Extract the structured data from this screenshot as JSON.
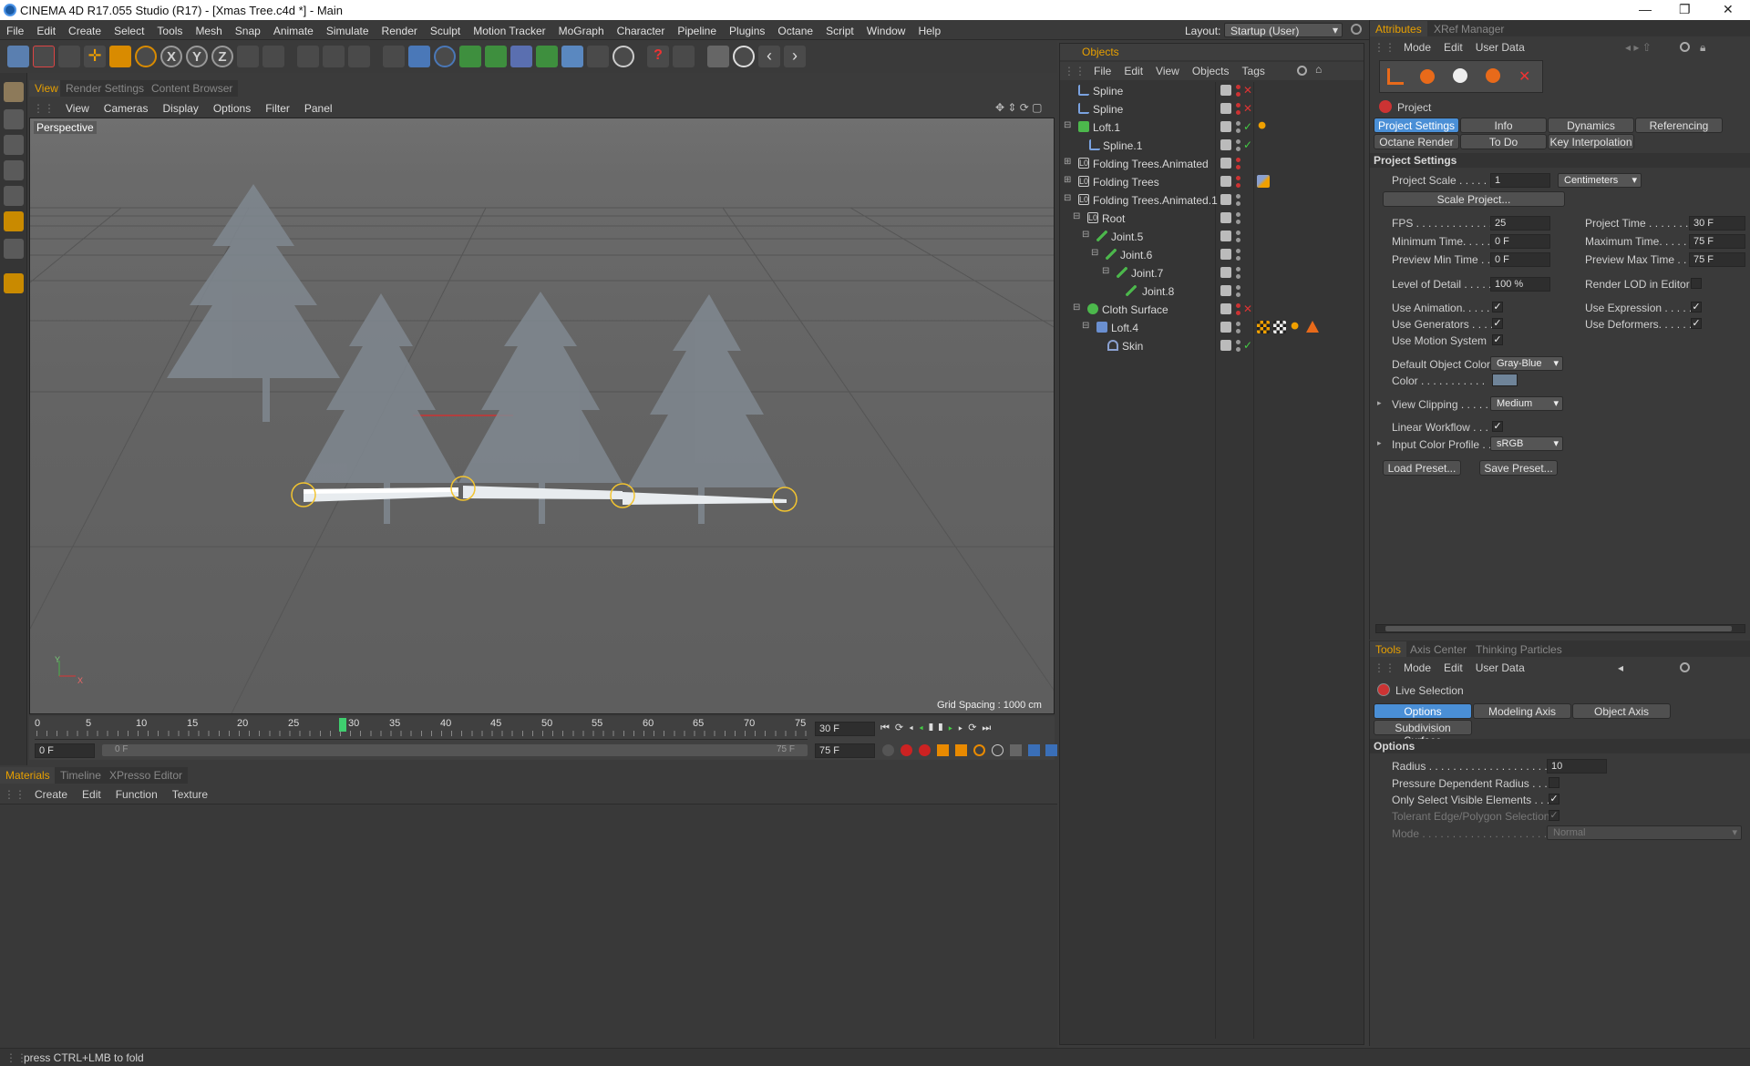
{
  "app": {
    "title": "CINEMA 4D R17.055 Studio (R17) - [Xmas Tree.c4d *] - Main",
    "minimize": "—",
    "maximize": "❐",
    "close": "✕"
  },
  "menubar": [
    "File",
    "Edit",
    "Create",
    "Select",
    "Tools",
    "Mesh",
    "Snap",
    "Animate",
    "Simulate",
    "Render",
    "Sculpt",
    "Motion Tracker",
    "MoGraph",
    "Character",
    "Pipeline",
    "Plugins",
    "Octane",
    "Script",
    "Window",
    "Help"
  ],
  "layout": {
    "label": "Layout:",
    "value": "Startup (User)"
  },
  "toolbar": {
    "axis_labels": [
      "X",
      "Y",
      "Z"
    ],
    "items": [
      "live-selection-icon",
      "move-icon",
      "scale-icon",
      "rotate-icon",
      "x-axis-icon",
      "y-axis-icon",
      "z-axis-icon",
      "coordinate-system-icon",
      "render-view-icon",
      "render-picture-viewer-icon",
      "edit-render-settings-icon",
      "cube-icon",
      "subdivision-icon",
      "array-icon",
      "spline-pen-icon",
      "deformer-icon",
      "scene-icon",
      "camera-icon",
      "light-icon",
      "help-icon"
    ]
  },
  "viewport": {
    "tabs": [
      "View",
      "Render Settings",
      "Content Browser"
    ],
    "menu": [
      "View",
      "Cameras",
      "Display",
      "Options",
      "Filter",
      "Panel"
    ],
    "label": "Perspective",
    "grid_spacing": "Grid Spacing : 1000 cm",
    "axis_y": "Y",
    "axis_x": "X"
  },
  "timeline": {
    "ticks": [
      "0",
      "5",
      "10",
      "15",
      "20",
      "25",
      "30",
      "35",
      "40",
      "45",
      "50",
      "55",
      "60",
      "65",
      "70",
      "75"
    ],
    "current_frame_fraction": 0.4,
    "current_frame": "30 F",
    "start_frame": "0 F",
    "range_start": "0 F",
    "range_end": "75 F",
    "end_frame": "75 F"
  },
  "materials": {
    "tabs": [
      "Materials",
      "Timeline",
      "XPresso Editor"
    ],
    "menu": [
      "Create",
      "Edit",
      "Function",
      "Texture"
    ]
  },
  "status": {
    "text": "press CTRL+LMB to fold"
  },
  "objects": {
    "title": "Objects",
    "menu": [
      "File",
      "Edit",
      "View",
      "Objects",
      "Tags"
    ],
    "rows": [
      {
        "name": "Spline",
        "icon": "spline-icon",
        "tags": []
      },
      {
        "name": "Spline",
        "icon": "spline-icon",
        "tags": []
      },
      {
        "name": "Loft.1",
        "icon": "loft-icon",
        "tags": [
          "phong-tag"
        ]
      },
      {
        "name": "Spline.1",
        "icon": "spline-icon",
        "tags": []
      },
      {
        "name": "Folding Trees.Animated",
        "icon": "null-icon",
        "tags": []
      },
      {
        "name": "Folding Trees",
        "icon": "null-icon",
        "tags": [
          "ik-tag"
        ]
      },
      {
        "name": "Folding Trees.Animated.1",
        "icon": "null-icon",
        "tags": []
      },
      {
        "name": "Root",
        "icon": "null-icon",
        "tags": []
      },
      {
        "name": "Joint.5",
        "icon": "joint-icon",
        "tags": []
      },
      {
        "name": "Joint.6",
        "icon": "joint-icon",
        "tags": []
      },
      {
        "name": "Joint.7",
        "icon": "joint-icon",
        "tags": []
      },
      {
        "name": "Joint.8",
        "icon": "joint-icon",
        "tags": []
      },
      {
        "name": "Cloth Surface",
        "icon": "cloth-surface-icon",
        "tags": []
      },
      {
        "name": "Loft.4",
        "icon": "loft-icon",
        "tags": [
          "texture-tag",
          "checker-tag",
          "phong-tag",
          "warning-tag"
        ]
      },
      {
        "name": "Skin",
        "icon": "skin-icon",
        "tags": []
      }
    ]
  },
  "attributes": {
    "tabs": [
      "Attributes",
      "XRef Manager"
    ],
    "menu": [
      "Mode",
      "Edit",
      "User Data"
    ],
    "object_label": "Project",
    "subtabs_row1": [
      "Project Settings",
      "Info",
      "Dynamics",
      "Referencing"
    ],
    "subtabs_row2": [
      "Octane Render",
      "To Do",
      "Key Interpolation"
    ],
    "section": "Project Settings",
    "project_scale": {
      "label": "Project Scale . . . . .",
      "value": "1",
      "unit": "Centimeters"
    },
    "scale_button": "Scale Project...",
    "fps": {
      "label": "FPS . . . . . . . . . . . . .",
      "value": "25"
    },
    "project_time": {
      "label": "Project Time . . . . . . .",
      "value": "30 F"
    },
    "min_time": {
      "label": "Minimum Time. . . . .",
      "value": "0 F"
    },
    "max_time": {
      "label": "Maximum Time. . . . . .",
      "value": "75 F"
    },
    "preview_min": {
      "label": "Preview Min Time . .",
      "value": "0 F"
    },
    "preview_max": {
      "label": "Preview Max Time . .",
      "value": "75 F"
    },
    "lod": {
      "label": "Level of Detail . . . . .",
      "value": "100 %"
    },
    "render_lod": {
      "label": "Render LOD in Editor",
      "checked": ""
    },
    "use_animation": {
      "label": "Use Animation. . . . .",
      "checked": "✓"
    },
    "use_expression": {
      "label": "Use Expression . . . . .",
      "checked": "✓"
    },
    "use_generators": {
      "label": "Use Generators . . . .",
      "checked": "✓"
    },
    "use_deformers": {
      "label": "Use Deformers. . . . . .",
      "checked": "✓"
    },
    "use_motion": {
      "label": "Use Motion System",
      "checked": "✓"
    },
    "default_color": {
      "label": "Default Object Color",
      "value": "Gray-Blue"
    },
    "color": {
      "label": "Color . . . . . . . . . . .",
      "swatch": "#6f8499"
    },
    "view_clipping": {
      "label": "View Clipping . . . . .",
      "value": "Medium"
    },
    "linear_workflow": {
      "label": "Linear Workflow . . .",
      "checked": "✓"
    },
    "input_profile": {
      "label": "Input Color Profile . .",
      "value": "sRGB"
    },
    "load_preset": "Load Preset...",
    "save_preset": "Save Preset..."
  },
  "tools": {
    "tabs": [
      "Tools",
      "Axis Center",
      "Thinking Particles"
    ],
    "menu": [
      "Mode",
      "Edit",
      "User Data"
    ],
    "tool_name": "Live Selection",
    "subtabs_row1": [
      "Options",
      "Modeling Axis",
      "Object Axis"
    ],
    "subtabs_row2": [
      "Subdivision Surface"
    ],
    "section": "Options",
    "radius": {
      "label": "Radius . . . . . . . . . . . . . . . . . . . . . . .",
      "value": "10"
    },
    "pressure": {
      "label": "Pressure Dependent Radius . . . .",
      "checked": ""
    },
    "visible_only": {
      "label": "Only Select Visible Elements . . . .",
      "checked": "✓"
    },
    "tolerant": {
      "label": "Tolerant Edge/Polygon Selection",
      "checked": "✓"
    },
    "mode": {
      "label": "Mode . . . . . . . . . . . . . . . . . . . . . . . .",
      "value": "Normal"
    }
  },
  "colors": {
    "accent": "#e8a000",
    "selected_tab": "#4a8fd6",
    "viewport_bg": "#646464"
  }
}
